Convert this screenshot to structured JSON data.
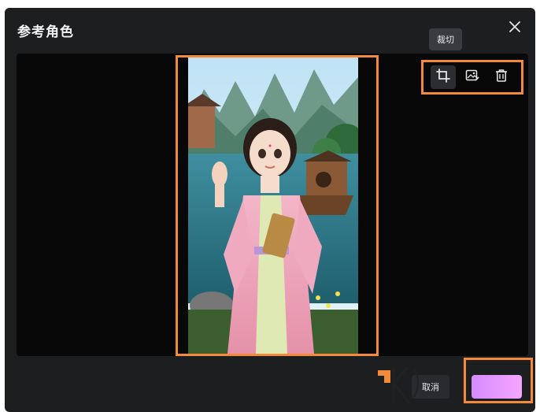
{
  "dialog": {
    "title": "参考角色",
    "close_icon": "close-icon"
  },
  "tooltip": {
    "label": "裁切"
  },
  "toolbar": {
    "items": [
      {
        "name": "crop",
        "icon": "crop-icon",
        "active": true
      },
      {
        "name": "replace-image",
        "icon": "image-edit-icon",
        "active": false
      },
      {
        "name": "delete",
        "icon": "trash-icon",
        "active": false
      }
    ]
  },
  "footer": {
    "cancel_label": "取消",
    "confirm_label": ""
  },
  "colors": {
    "highlight": "#f28a3a",
    "dialog_bg": "#1d1e20",
    "canvas_bg": "#080808",
    "accent": "#d58bff"
  }
}
